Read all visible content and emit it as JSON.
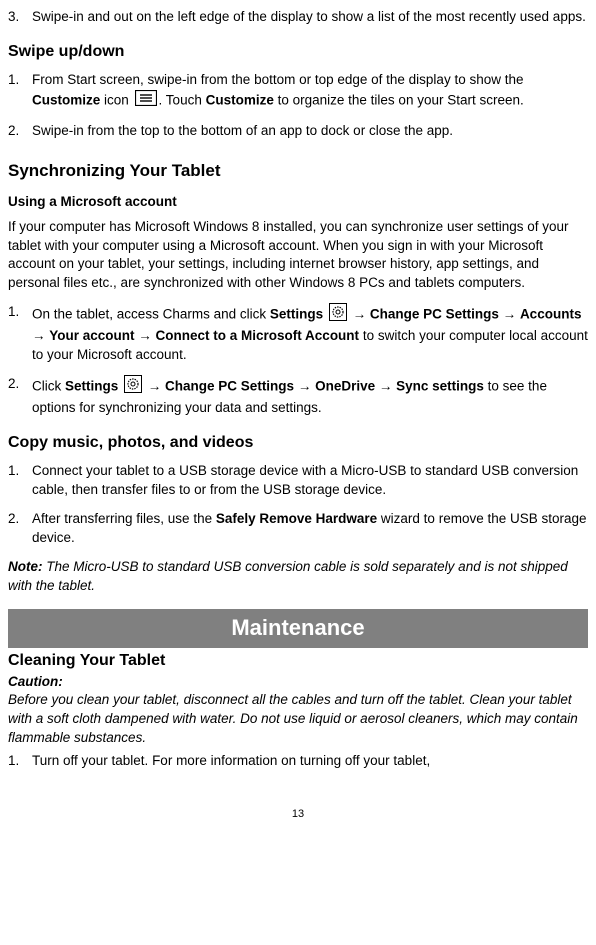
{
  "items": {
    "pre_item3_num": "3.",
    "pre_item3_txt": "Swipe-in and out on the left edge of the display to show a list of the most recently used apps."
  },
  "swipe_heading": "Swipe up/down",
  "swipe_items": {
    "i1_num": "1.",
    "i1_a": "From Start screen, swipe-in from the bottom or top edge of the display to show the ",
    "i1_b": "Customize",
    "i1_c": " icon ",
    "i1_d": ". Touch ",
    "i1_e": "Customize",
    "i1_f": " to organize the tiles on your Start screen.",
    "i2_num": "2.",
    "i2_txt": "Swipe-in from the top to the bottom of an app to dock or close the app."
  },
  "sync_heading": "Synchronizing Your Tablet",
  "sync_sub": "Using a Microsoft account",
  "sync_para": "If your computer has Microsoft Windows 8 installed, you can synchronize user settings of your tablet with your computer using a Microsoft account. When you sign in with your Microsoft account on your tablet, your settings, including internet browser history, app settings, and personal files etc., are synchronized with other Windows 8 PCs and tablets computers.",
  "sync_items": {
    "i1_num": "1.",
    "i1_a": "On the tablet, access Charms and click ",
    "i1_b": "Settings",
    "i1_c": "  → ",
    "i1_d": "Change PC Settings",
    "i1_e": " → ",
    "i1_f": "Accounts",
    "i1_g": " → ",
    "i1_h": "Your account",
    "i1_i": " → ",
    "i1_j": "Connect to a Microsoft Account",
    "i1_k": " to switch your computer local account to your Microsoft account.",
    "i2_num": "2.",
    "i2_a": "Click ",
    "i2_b": "Settings",
    "i2_c": "  → ",
    "i2_d": "Change PC Settings",
    "i2_e": " → ",
    "i2_f": "OneDrive",
    "i2_g": " → ",
    "i2_h": "Sync settings",
    "i2_i": " to see the options for synchronizing your data and settings."
  },
  "copy_heading": "Copy music, photos, and videos",
  "copy_items": {
    "i1_num": "1.",
    "i1_txt": "Connect your tablet to a USB storage device with a Micro-USB to standard USB conversion cable, then transfer files to or from the USB storage device.",
    "i2_num": "2.",
    "i2_a": "After transferring files, use the ",
    "i2_b": "Safely Remove Hardware",
    "i2_c": " wizard to remove the USB storage device."
  },
  "note_label": "Note:",
  "note_body": " The Micro-USB to standard USB conversion cable is sold separately and is not shipped with the tablet.",
  "maint_heading": "Maintenance",
  "clean_heading": "Cleaning Your Tablet",
  "caution_label": "Caution:",
  "caution_body": "Before you clean your tablet, disconnect all the cables and turn off the tablet. Clean your tablet with a soft cloth dampened with water. Do not use liquid or aerosol cleaners, which may contain flammable substances.",
  "clean_items": {
    "i1_num": "1.",
    "i1_txt": "Turn off your tablet. For more information on turning off your tablet,"
  },
  "page_number": "13"
}
